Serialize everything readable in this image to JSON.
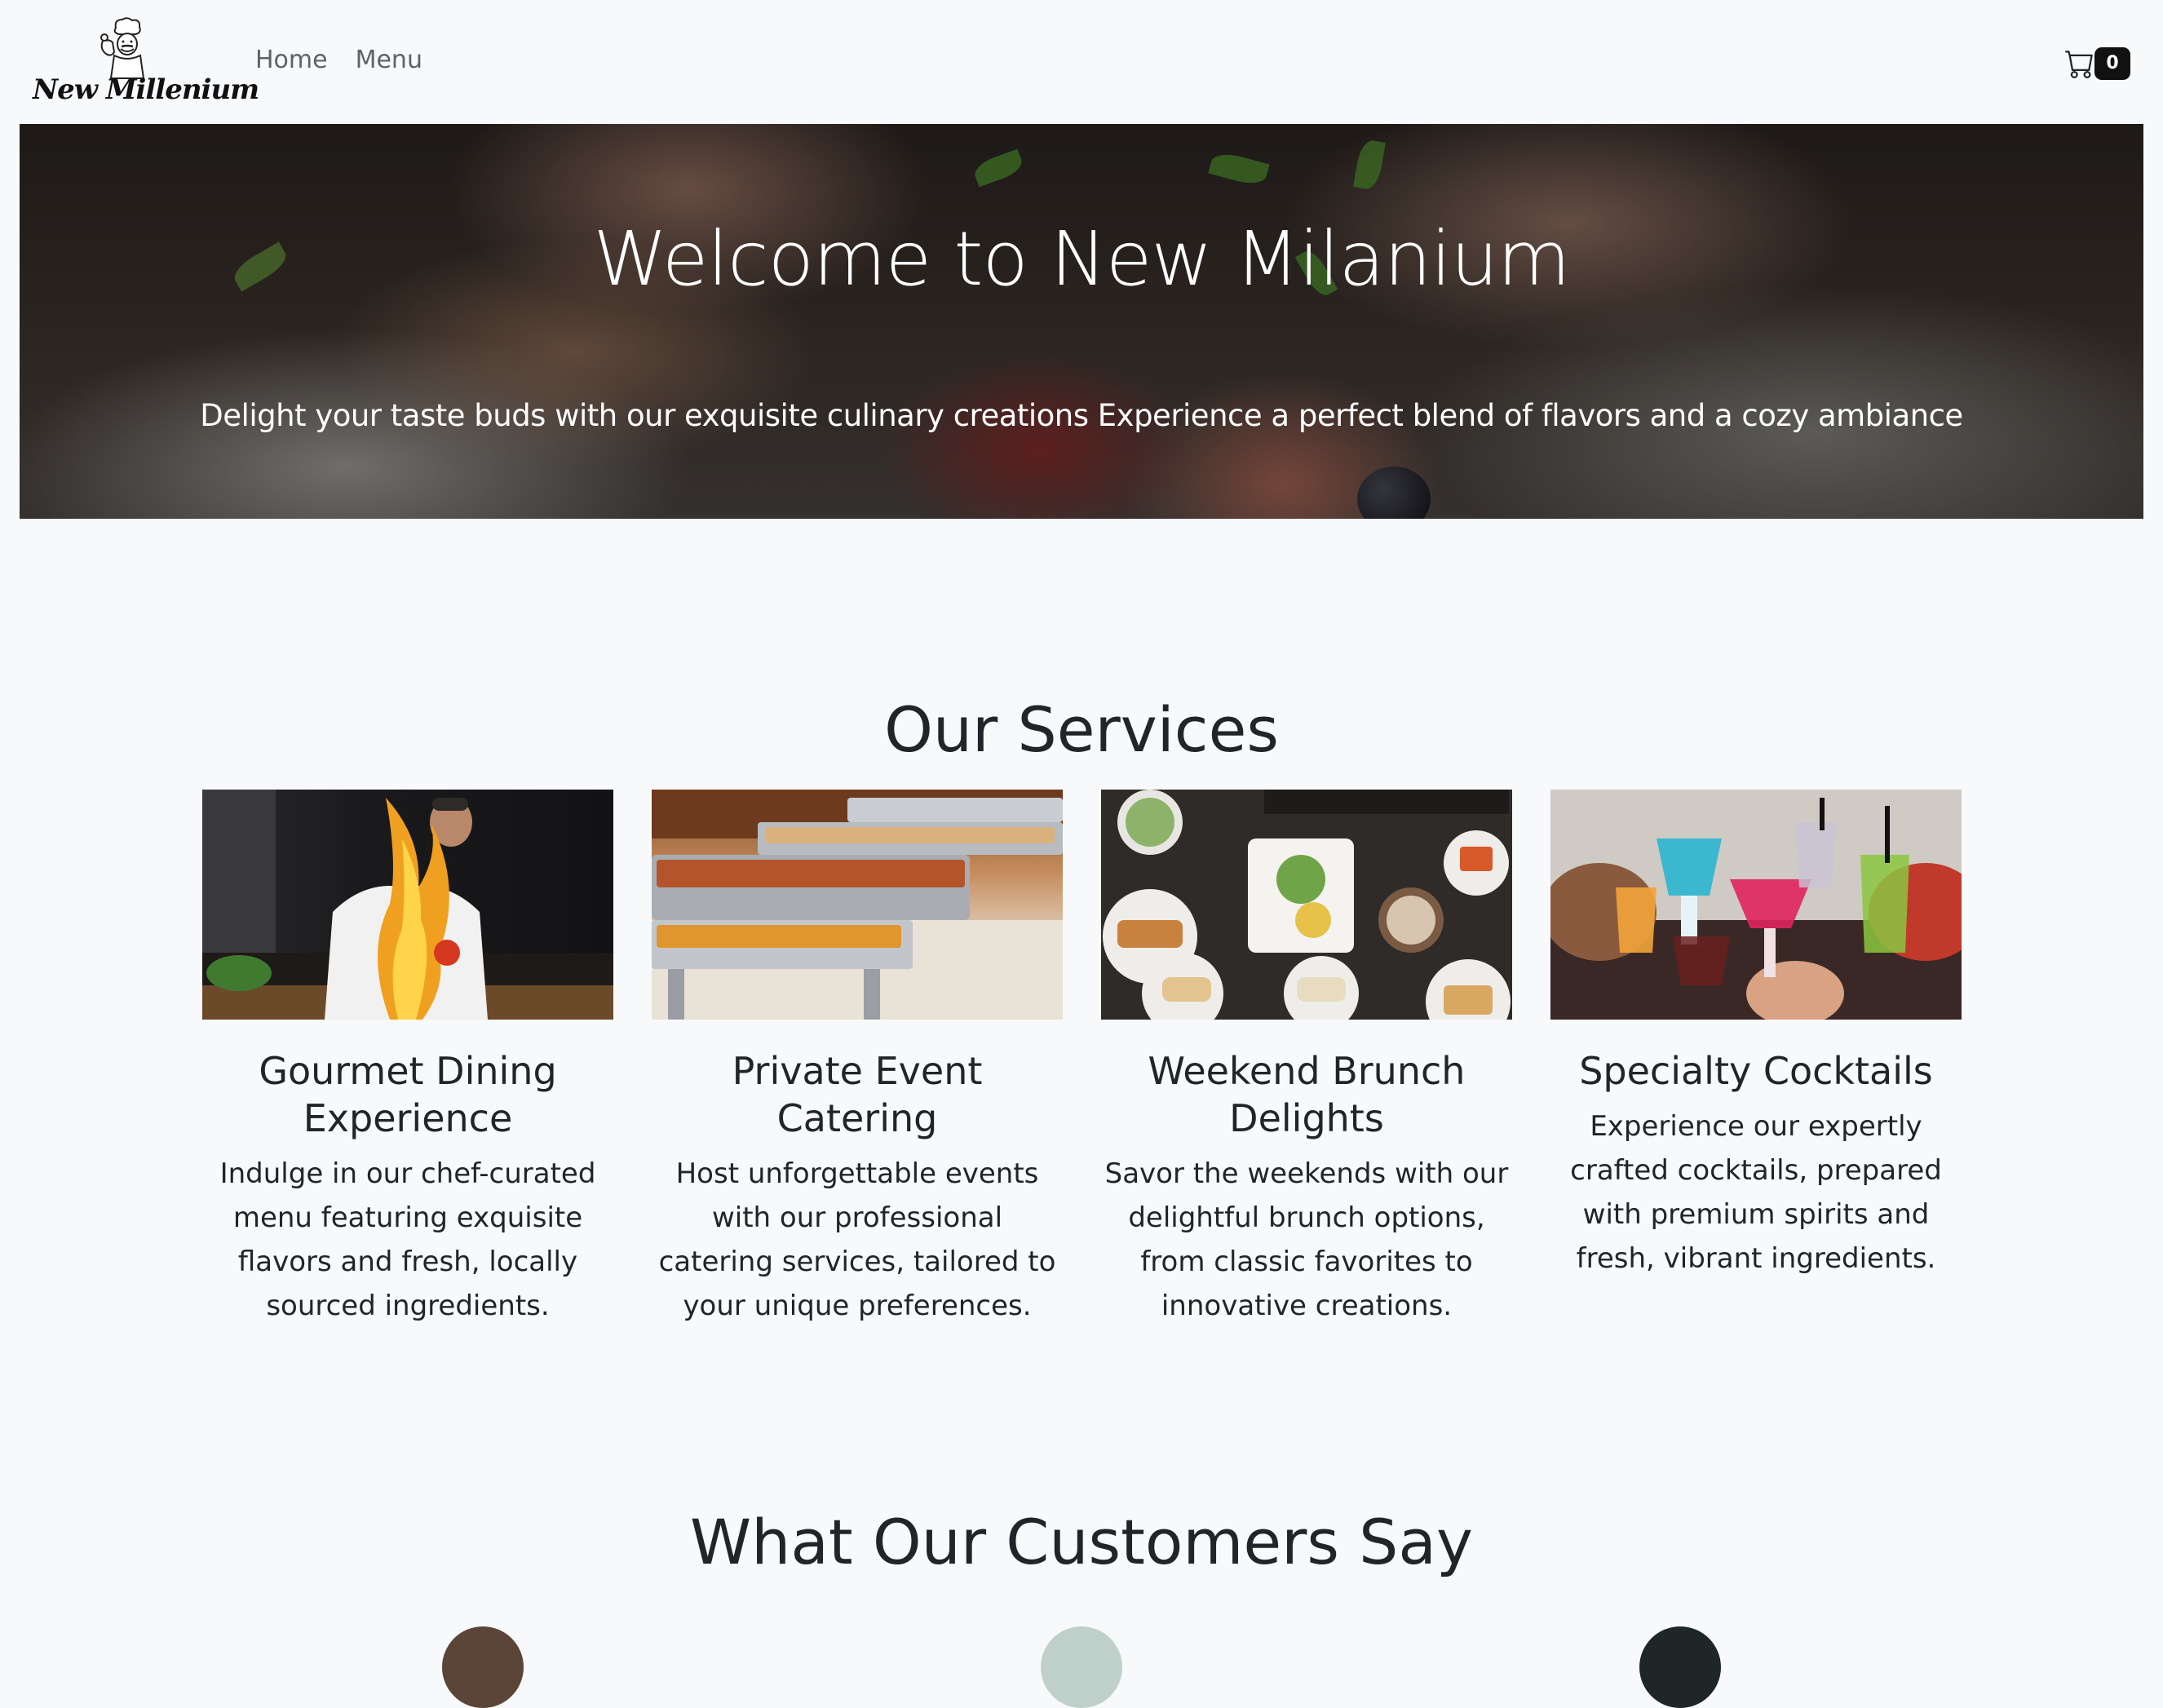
{
  "navbar": {
    "brand_text": "New Millenium",
    "links": [
      "Home",
      "Menu"
    ],
    "cart_count": "0"
  },
  "hero": {
    "title": "Welcome to New Milanium",
    "subtitle": "Delight your taste buds with our exquisite culinary creations Experience a perfect blend of flavors and a cozy ambiance"
  },
  "services": {
    "title": "Our Services",
    "items": [
      {
        "title": "Gourmet Dining Experience",
        "text": "Indulge in our chef-curated menu featuring exquisite flavors and fresh, locally sourced ingredients."
      },
      {
        "title": "Private Event Catering",
        "text": "Host unforgettable events with our professional catering services, tailored to your unique preferences."
      },
      {
        "title": "Weekend Brunch Delights",
        "text": "Savor the weekends with our delightful brunch options, from classic favorites to innovative creations."
      },
      {
        "title": "Specialty Cocktails",
        "text": "Experience our expertly crafted cocktails, prepared with premium spirits and fresh, vibrant ingredients."
      }
    ]
  },
  "testimonials": {
    "title": "What Our Customers Say"
  },
  "icons": {
    "cart": "cart-icon",
    "logo": "chef-logo-icon"
  },
  "colors": {
    "background": "#f8f9fa",
    "text": "#212529",
    "nav_link": "#5c636a",
    "badge": "#111111"
  }
}
